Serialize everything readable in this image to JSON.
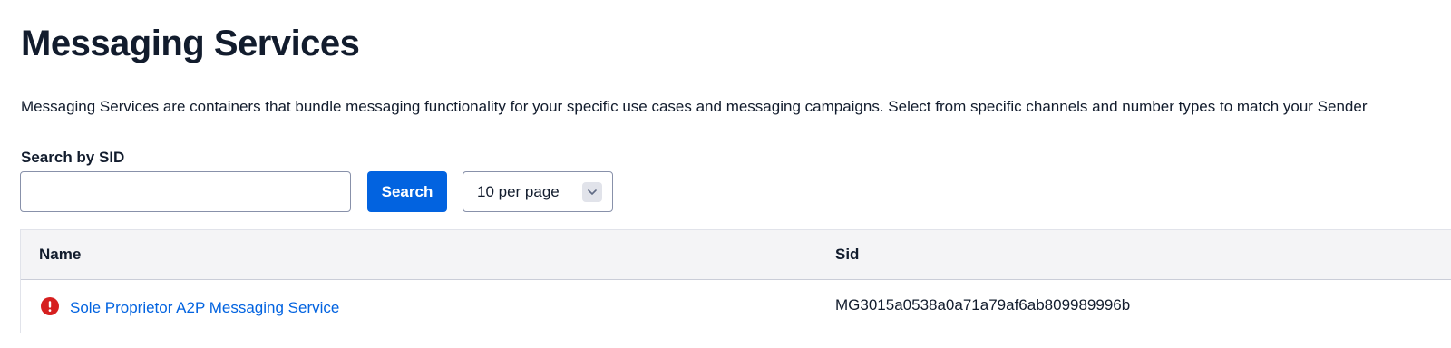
{
  "page": {
    "title": "Messaging Services",
    "description": "Messaging Services are containers that bundle messaging functionality for your specific use cases and messaging campaigns. Select from specific channels and number types to match your Sender"
  },
  "search": {
    "label": "Search by SID",
    "value": "",
    "placeholder": "",
    "button_label": "Search"
  },
  "pagination": {
    "per_page_selected": "10 per page"
  },
  "table": {
    "columns": [
      "Name",
      "Sid"
    ],
    "rows": [
      {
        "status_icon": "error-icon",
        "name": "Sole Proprietor A2P Messaging Service",
        "sid": "MG3015a0538a0a71a79af6ab809989996b"
      }
    ]
  },
  "colors": {
    "primary": "#0263e0",
    "error": "#d61f1f",
    "text": "#121c2d",
    "header_bg": "#f4f4f6"
  }
}
